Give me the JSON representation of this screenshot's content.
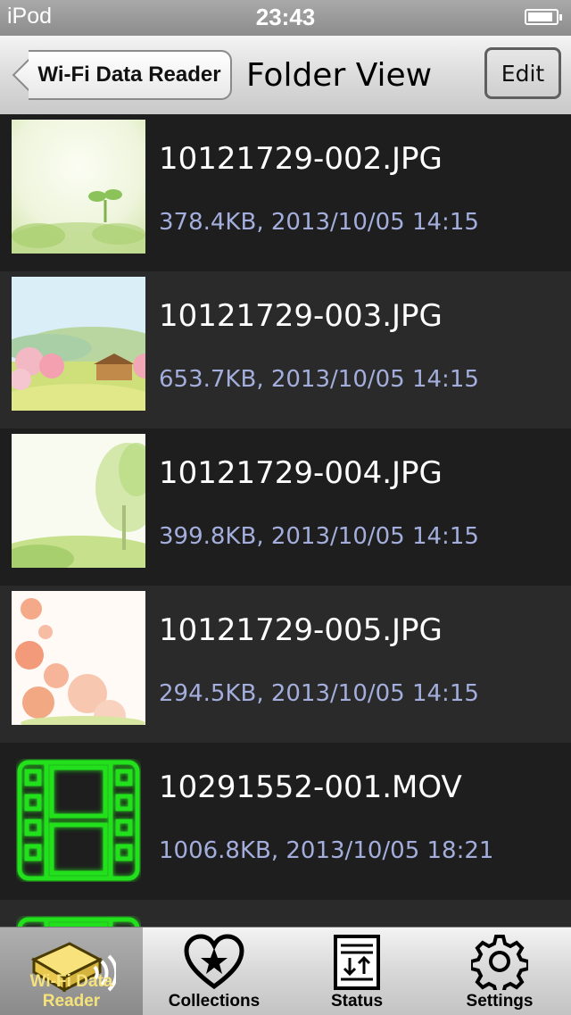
{
  "status_bar": {
    "carrier": "iPod",
    "time": "23:43",
    "battery_level": 0.9
  },
  "nav": {
    "back_label": "Wi-Fi Data Reader",
    "title": "Folder View",
    "edit_label": "Edit"
  },
  "files": [
    {
      "name": "10121729-002.JPG",
      "meta": "378.4KB, 2013/10/05 14:15",
      "type": "image"
    },
    {
      "name": "10121729-003.JPG",
      "meta": "653.7KB, 2013/10/05 14:15",
      "type": "image"
    },
    {
      "name": "10121729-004.JPG",
      "meta": "399.8KB, 2013/10/05 14:15",
      "type": "image"
    },
    {
      "name": "10121729-005.JPG",
      "meta": "294.5KB, 2013/10/05 14:15",
      "type": "image"
    },
    {
      "name": "10291552-001.MOV",
      "meta": "1006.8KB, 2013/10/05 18:21",
      "type": "movie"
    }
  ],
  "tabs": [
    {
      "label": "Wi-Fi Data Reader",
      "icon": "wifi-reader-icon",
      "selected": true
    },
    {
      "label": "Collections",
      "icon": "heart-star-icon",
      "selected": false
    },
    {
      "label": "Status",
      "icon": "status-document-icon",
      "selected": false
    },
    {
      "label": "Settings",
      "icon": "gear-icon",
      "selected": false
    }
  ],
  "colors": {
    "meta_text": "#a3aedd",
    "movie_icon": "#22e01e",
    "selected_tab_text": "#f6e27a"
  }
}
